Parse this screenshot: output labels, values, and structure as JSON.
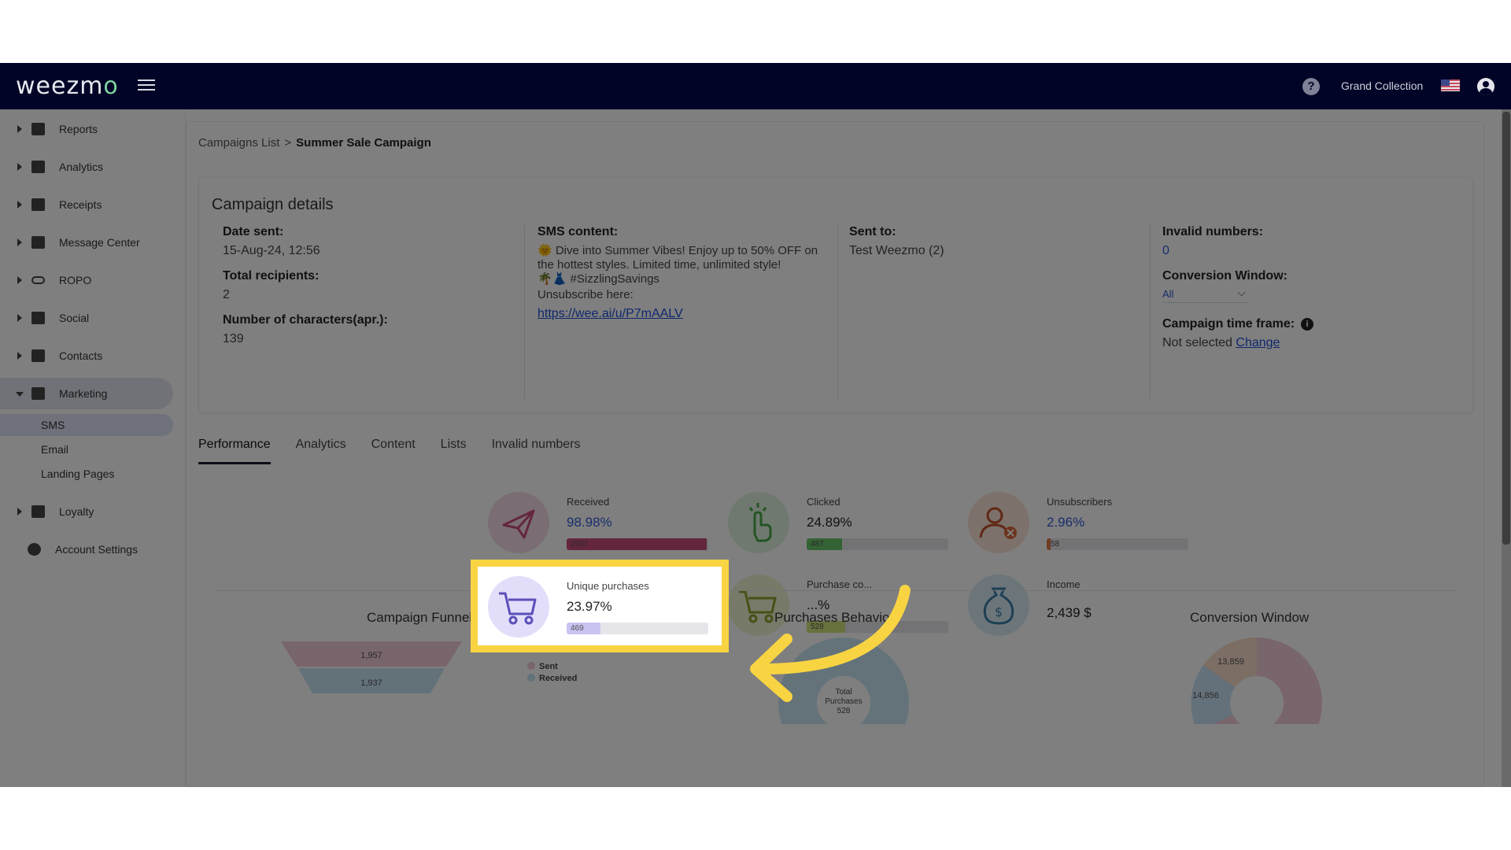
{
  "topbar": {
    "logo": "weezmo",
    "account_name": "Grand Collection"
  },
  "sidebar": {
    "items": [
      {
        "label": "Reports"
      },
      {
        "label": "Analytics"
      },
      {
        "label": "Receipts"
      },
      {
        "label": "Message Center"
      },
      {
        "label": "ROPO"
      },
      {
        "label": "Social"
      },
      {
        "label": "Contacts"
      },
      {
        "label": "Marketing"
      },
      {
        "label": "Loyalty"
      },
      {
        "label": "Account Settings"
      }
    ],
    "marketing_sub": [
      {
        "label": "SMS"
      },
      {
        "label": "Email"
      },
      {
        "label": "Landing Pages"
      }
    ]
  },
  "breadcrumb": {
    "parent": "Campaigns List",
    "separator": ">",
    "current": "Summer Sale Campaign"
  },
  "details": {
    "title": "Campaign details",
    "date_sent_label": "Date sent:",
    "date_sent_value": "15-Aug-24, 12:56",
    "total_recipients_label": "Total recipients:",
    "total_recipients_value": "2",
    "num_chars_label": "Number of characters(apr.):",
    "num_chars_value": "139",
    "sms_content_label": "SMS content:",
    "sms_line1": "🌞 Dive into Summer Vibes! Enjoy up to 50% OFF on the hottest styles. Limited time, unlimited style!",
    "sms_line2": "🌴👗 #SizzlingSavings",
    "sms_unsub": "Unsubscribe here:",
    "sms_link": "https://wee.ai/u/P7mAALV",
    "sent_to_label": "Sent to:",
    "sent_to_value": "Test Weezmo (2)",
    "invalid_label": "Invalid numbers:",
    "invalid_value": "0",
    "conv_window_label": "Conversion Window:",
    "conv_window_value": "All",
    "timeframe_label": "Campaign time frame:",
    "timeframe_value": "Not selected",
    "timeframe_change": "Change"
  },
  "tabs": [
    "Performance",
    "Analytics",
    "Content",
    "Lists",
    "Invalid numbers"
  ],
  "metrics": {
    "received": {
      "label": "Received",
      "value": "98.98%",
      "count": "1937",
      "fill": 0.99,
      "color": "#c94d7e"
    },
    "clicked": {
      "label": "Clicked",
      "value": "24.89%",
      "count": "487",
      "fill": 0.25,
      "color": "#6bc46b"
    },
    "unsubscribers": {
      "label": "Unsubscribers",
      "value": "2.96%",
      "count": "58",
      "fill": 0.03,
      "color": "#e07a4a"
    },
    "unique_purchases": {
      "label": "Unique purchases",
      "value": "23.97%",
      "count": "469",
      "fill": 0.24,
      "color": "#c9c3f2"
    },
    "purchase_conv": {
      "label": "Purchase co...",
      "value": "...%",
      "count": "528",
      "fill": 0.27,
      "color": "#cfe37a"
    },
    "income": {
      "label": "Income",
      "value": "2,439 $"
    }
  },
  "charts": {
    "funnel_title": "Campaign Funnel",
    "behavior_title": "Purchases Behavior",
    "conv_title": "Conversion Window"
  },
  "chart_data": [
    {
      "type": "bar",
      "title": "Campaign Funnel",
      "categories": [
        "Sent",
        "Received"
      ],
      "values": [
        1957,
        1937
      ]
    },
    {
      "type": "pie",
      "title": "Purchases Behavior",
      "center_label_1": "Total",
      "center_label_2": "Purchases",
      "total": 528
    },
    {
      "type": "pie",
      "title": "Conversion Window",
      "labels": [
        "13,859",
        "14,856"
      ]
    }
  ]
}
